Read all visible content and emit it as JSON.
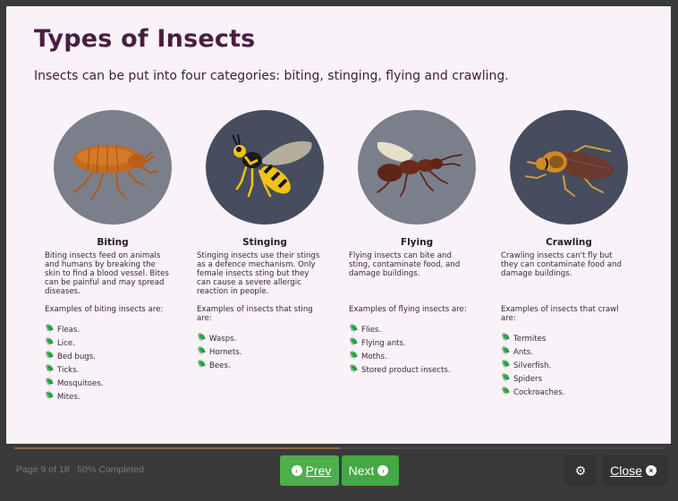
{
  "header": {
    "title": "Types of Insects",
    "subtitle": "Insects can be put into four categories: biting, stinging, flying and crawling."
  },
  "categories": [
    {
      "name": "Biting",
      "image": "bed-bug",
      "circle_color": "#7b7f8c",
      "description": "Biting insects feed on animals and humans by breaking the skin to find a blood vessel. Bites can be painful and may spread diseases.",
      "examples_intro": "Examples of biting insects are:",
      "examples": [
        "Fleas.",
        "Lice.",
        "Bed bugs.",
        "Ticks.",
        "Mosquitoes.",
        "Mites."
      ]
    },
    {
      "name": "Stinging",
      "image": "wasp",
      "circle_color": "#454d5e",
      "description": "Stinging insects use their stings as a defence mechanism. Only female insects sting but they can cause a severe allergic reaction in people.",
      "examples_intro": "Examples of insects that sting are:",
      "examples": [
        "Wasps.",
        "Hornets.",
        "Bees."
      ]
    },
    {
      "name": "Flying",
      "image": "flying-ant",
      "circle_color": "#7b7f8c",
      "description": "Flying insects can bite and sting, contaminate food, and damage buildings.",
      "examples_intro": "Examples of flying insects are:",
      "examples": [
        "Flies.",
        "Flying ants.",
        "Moths.",
        "Stored product insects."
      ]
    },
    {
      "name": "Crawling",
      "image": "cockroach",
      "circle_color": "#454d5e",
      "description": "Crawling insects can't fly but they can contaminate food and damage buildings.",
      "examples_intro": "Examples of insects that crawl are:",
      "examples": [
        "Termites",
        "Ants.",
        "Silverfish.",
        "Spiders",
        "Cockroaches."
      ]
    }
  ],
  "footer": {
    "page_info": "Page 9 of 18   50% Completed",
    "progress_percent": 50,
    "prev_label": "Prev",
    "next_label": "Next",
    "close_label": "Close",
    "prev_icon": "chevron-left-circle-icon",
    "next_icon": "chevron-right-circle-icon",
    "settings_icon": "gears-icon",
    "close_icon": "close-circle-icon",
    "button_green": "#4cae4c"
  }
}
